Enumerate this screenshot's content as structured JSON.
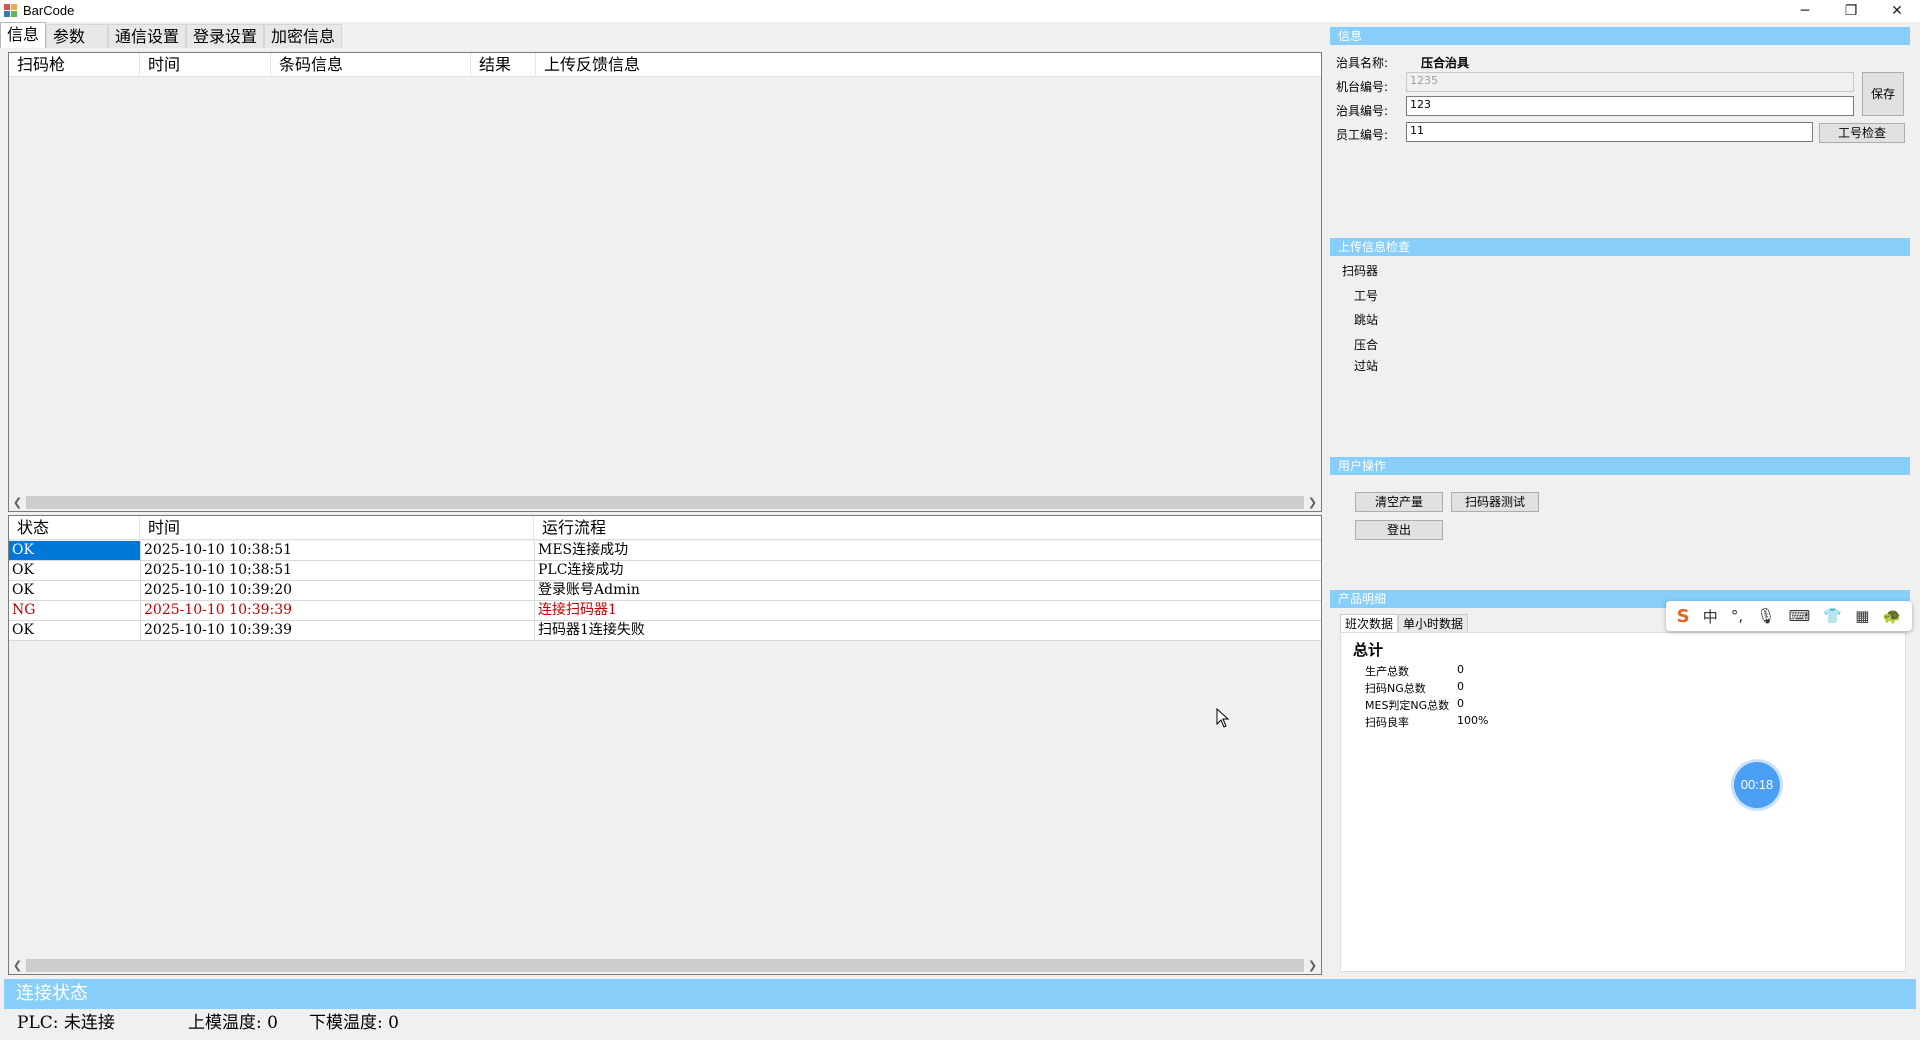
{
  "window": {
    "title": "BarCode",
    "minimize": "─",
    "restore": "❐",
    "close": "✕"
  },
  "tabs": [
    {
      "label": "信息"
    },
    {
      "label": "参数"
    },
    {
      "label": "通信设置"
    },
    {
      "label": "登录设置"
    },
    {
      "label": "加密信息"
    }
  ],
  "scan_list": {
    "columns": [
      "扫码枪",
      "时间",
      "条码信息",
      "结果",
      "上传反馈信息"
    ]
  },
  "log_list": {
    "columns": [
      "状态",
      "时间",
      "运行流程"
    ],
    "rows": [
      {
        "status": "OK",
        "time": "2025-10-10 10:38:51",
        "flow": "MES连接成功",
        "selected": true,
        "error": false
      },
      {
        "status": "OK",
        "time": "2025-10-10 10:38:51",
        "flow": "PLC连接成功",
        "selected": false,
        "error": false
      },
      {
        "status": "OK",
        "time": "2025-10-10 10:39:20",
        "flow": "登录账号Admin",
        "selected": false,
        "error": false
      },
      {
        "status": "NG",
        "time": "2025-10-10 10:39:39",
        "flow": "连接扫码器1",
        "selected": false,
        "error": true
      },
      {
        "status": "OK",
        "time": "2025-10-10 10:39:39",
        "flow": "扫码器1连接失败",
        "selected": false,
        "error": false
      }
    ]
  },
  "info_panel": {
    "header": "信息",
    "fixture_name_label": "治具名称:",
    "fixture_name_value": "压合治具",
    "machine_no_label": "机台编号:",
    "machine_no_value": "1235",
    "fixture_no_label": "治具编号:",
    "fixture_no_value": "123",
    "employee_no_label": "员工编号:",
    "employee_no_value": "11",
    "save_button": "保存",
    "check_button": "工号检查"
  },
  "upload_check": {
    "header": "上传信息检查",
    "root": "扫码器",
    "items": [
      "工号",
      "跳站",
      "压合",
      "过站"
    ]
  },
  "user_ops": {
    "header": "用户操作",
    "clear_button": "清空产量",
    "scanner_test_button": "扫码器测试",
    "logout_button": "登出"
  },
  "product_detail": {
    "header": "产品明细",
    "tabs": [
      "班次数据",
      "单小时数据"
    ],
    "total_label": "总计",
    "stats": [
      {
        "label": "生产总数",
        "value": "0"
      },
      {
        "label": "扫码NG总数",
        "value": "0"
      },
      {
        "label": "MES判定NG总数",
        "value": "0"
      },
      {
        "label": "扫码良率",
        "value": "100%"
      }
    ]
  },
  "ime_toolbar": {
    "logo": "S",
    "mode": "中",
    "punct": "°,",
    "mic": "🎙",
    "keyboard": "⌨",
    "skin": "👕",
    "apps": "▦",
    "extra": "🐢"
  },
  "timer": {
    "text": "00:18"
  },
  "status": {
    "header": "连接状态",
    "plc": "PLC: 未连接",
    "upper_temp": "上模温度: 0",
    "lower_temp": "下模温度: 0"
  },
  "colors": {
    "accent": "#87cefa",
    "selection": "#0078d7",
    "error": "#c00000"
  }
}
